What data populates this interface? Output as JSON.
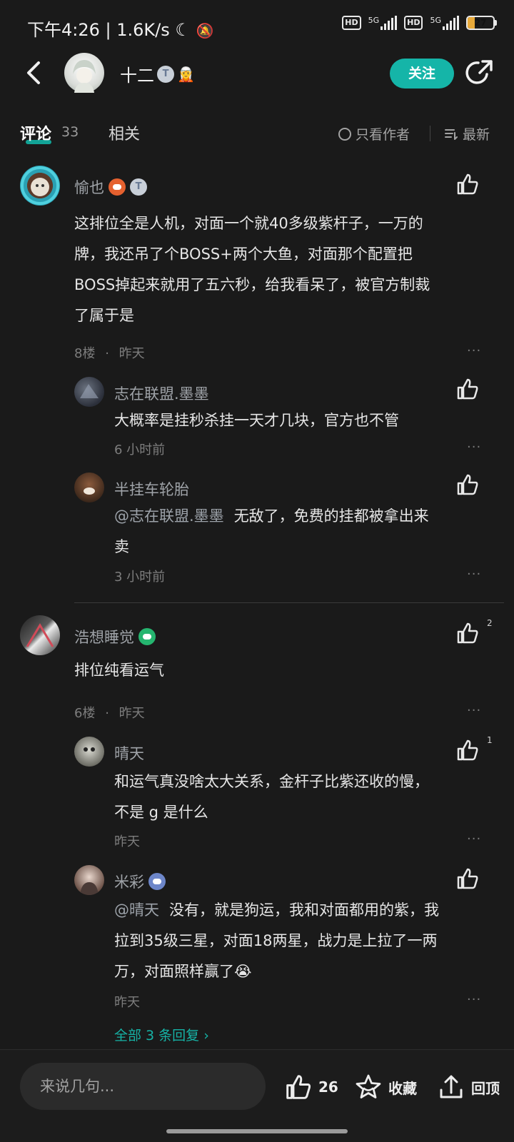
{
  "status_bar": {
    "time": "下午4:26",
    "speed": "1.6K/s",
    "hd1": "HD",
    "net1": "5G",
    "hd2": "HD",
    "net2": "5G",
    "battery": "27",
    "battery_level": 0.27
  },
  "header": {
    "author_name": "十二",
    "badge_t": "T",
    "follow_label": "关注"
  },
  "tabs": {
    "comments_label": "评论",
    "comments_count": "33",
    "related_label": "相关",
    "only_author_label": "只看作者",
    "newest_label": "最新"
  },
  "comments": [
    {
      "user": "愉也",
      "text_lines": [
        "这排位全是人机，对面一个就40多级紫杆子，一万的",
        "牌，我还吊了个BOSS+两个大鱼，对面那个配置把",
        "BOSS掉起来就用了五六秒，给我看呆了，被官方制裁",
        "了属于是"
      ],
      "floor": "8楼",
      "dot": "·",
      "time": "昨天",
      "replies": [
        {
          "user": "志在联盟.墨墨",
          "text_lines": [
            "大概率是挂秒杀挂一天才几块，官方也不管"
          ],
          "time": "6 小时前"
        },
        {
          "user": "半挂车轮胎",
          "mention": "@志在联盟.墨墨",
          "text_lines": [
            "无敌了，免费的挂都被拿出来",
            "卖"
          ],
          "time": "3 小时前"
        }
      ]
    },
    {
      "user": "浩想睡觉",
      "like_count": "2",
      "text_lines": [
        "排位纯看运气"
      ],
      "floor": "6楼",
      "dot": "·",
      "time": "昨天",
      "replies": [
        {
          "user": "晴天",
          "like_count": "1",
          "text_lines": [
            "和运气真没啥太大关系，金杆子比紫还收的慢，",
            "不是 g 是什么"
          ],
          "time": "昨天"
        },
        {
          "user": "米彩",
          "mention": "@晴天",
          "text_lines": [
            "没有，就是狗运，我和对面都用的紫，我",
            "拉到35级三星，对面18两星，战力是上拉了一两",
            "万，对面照样赢了😭"
          ],
          "time": "昨天"
        }
      ],
      "all_replies_label": "全部 3 条回复 ›"
    }
  ],
  "bottom_bar": {
    "input_placeholder": "来说几句...",
    "like_count": "26",
    "collect_label": "收藏",
    "top_label": "回顶"
  },
  "more_label": "···"
}
